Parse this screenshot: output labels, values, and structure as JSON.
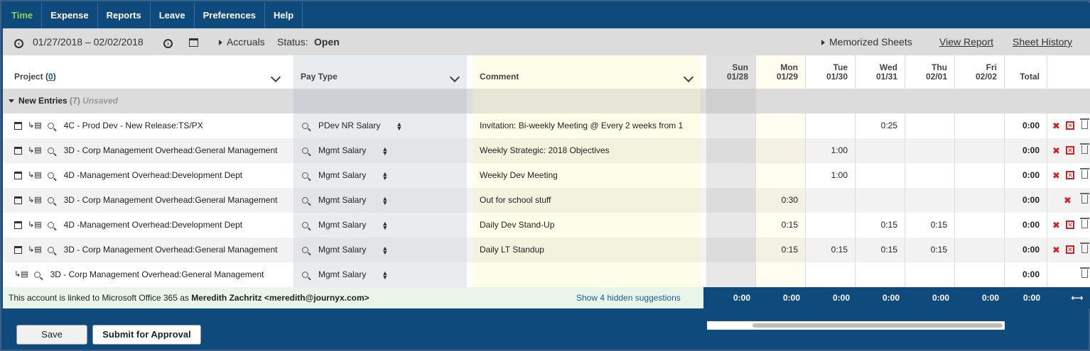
{
  "nav": {
    "tabs": [
      {
        "label": "Time",
        "active": true
      },
      {
        "label": "Expense"
      },
      {
        "label": "Reports"
      },
      {
        "label": "Leave"
      },
      {
        "label": "Preferences"
      },
      {
        "label": "Help"
      }
    ]
  },
  "toolbar": {
    "date_range": "01/27/2018 – 02/02/2018",
    "accruals": "Accruals",
    "status_label": "Status:",
    "status_value": "Open",
    "memorized_sheets": "Memorized Sheets",
    "view_report": "View Report",
    "sheet_history": "Sheet History"
  },
  "headers": {
    "project_prefix": "Project (",
    "project_count": "0",
    "project_suffix": ")",
    "pay_type": "Pay Type",
    "comment": "Comment",
    "days": [
      {
        "dow": "Sun",
        "date": "01/28"
      },
      {
        "dow": "Mon",
        "date": "01/29"
      },
      {
        "dow": "Tue",
        "date": "01/30"
      },
      {
        "dow": "Wed",
        "date": "01/31"
      },
      {
        "dow": "Thu",
        "date": "02/01"
      },
      {
        "dow": "Fri",
        "date": "02/02"
      }
    ],
    "total": "Total"
  },
  "group": {
    "label": "New Entries",
    "count": "(7)",
    "state": "Unsaved"
  },
  "rows": [
    {
      "project": "4C - Prod Dev - New Release:TS/PX",
      "pay_type": "PDev NR Salary",
      "comment": "Invitation: Bi-weekly Meeting @ Every 2 weeks from 1",
      "days": [
        "",
        "",
        "",
        "0:25",
        "",
        ""
      ],
      "total": "0:00"
    },
    {
      "project": "3D - Corp Management Overhead:General Management",
      "pay_type": "Mgmt Salary",
      "comment": "Weekly Strategic: 2018 Objectives",
      "days": [
        "",
        "",
        "1:00",
        "",
        "",
        ""
      ],
      "total": "0:00"
    },
    {
      "project": "4D -Management Overhead:Development Dept",
      "pay_type": "Mgmt Salary",
      "comment": "Weekly Dev Meeting",
      "days": [
        "",
        "",
        "1:00",
        "",
        "",
        ""
      ],
      "total": "0:00"
    },
    {
      "project": "3D - Corp Management Overhead:General Management",
      "pay_type": "Mgmt Salary",
      "comment": "Out for school stuff",
      "days": [
        "",
        "0:30",
        "",
        "",
        "",
        ""
      ],
      "total": "0:00"
    },
    {
      "project": "4D -Management Overhead:Development Dept",
      "pay_type": "Mgmt Salary",
      "comment": "Daily Dev Stand-Up",
      "days": [
        "",
        "0:15",
        "",
        "0:15",
        "0:15",
        ""
      ],
      "total": "0:00"
    },
    {
      "project": "3D - Corp Management Overhead:General Management",
      "pay_type": "Mgmt Salary",
      "comment": "Daily LT Standup",
      "days": [
        "",
        "0:15",
        "0:15",
        "0:15",
        "0:15",
        ""
      ],
      "total": "0:00"
    },
    {
      "project": "3D - Corp Management Overhead:General Management",
      "pay_type": "Mgmt Salary",
      "comment": "",
      "days": [
        "",
        "",
        "",
        "",
        "",
        ""
      ],
      "total": "0:00"
    }
  ],
  "footer": {
    "linked_text": "This account is linked to Microsoft Office 365 as",
    "linked_user": "Meredith Zachritz <meredith@journyx.com>",
    "hidden_suggestions": "Show 4 hidden suggestions",
    "totals": [
      "0:00",
      "0:00",
      "0:00",
      "0:00",
      "0:00",
      "0:00",
      "0:00"
    ],
    "resize_glyph": "⟷"
  },
  "buttons": {
    "save": "Save",
    "submit": "Submit for Approval"
  },
  "colors": {
    "nav_bg": "#0e4a7c",
    "active_tab": "#8fd14f",
    "comment_bg": "#fdfde9",
    "delete_red": "#d62020"
  }
}
